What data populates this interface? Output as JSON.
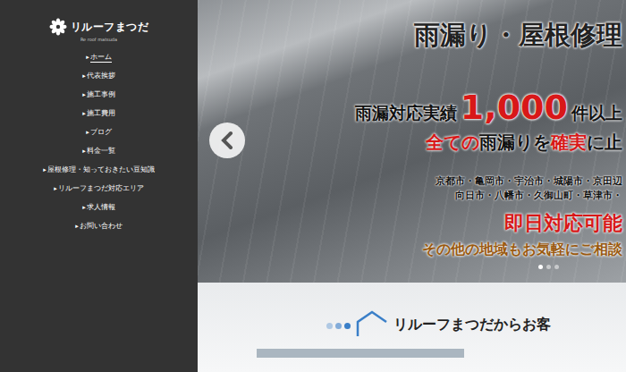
{
  "logo": {
    "name": "リルーフまつだ",
    "sub": "Re roof matsuda"
  },
  "nav_marker": "▸",
  "nav": [
    {
      "label": "ホーム",
      "selected": true
    },
    {
      "label": "代表挨拶",
      "selected": false
    },
    {
      "label": "施工事例",
      "selected": false
    },
    {
      "label": "施工費用",
      "selected": false
    },
    {
      "label": "ブログ",
      "selected": false
    },
    {
      "label": "料金一覧",
      "selected": false
    },
    {
      "label": "屋根修理・知っておきたい豆知識",
      "selected": false
    },
    {
      "label": "リルーフまつだ対応エリア",
      "selected": false
    },
    {
      "label": "求人情報",
      "selected": false
    },
    {
      "label": "お問い合わせ",
      "selected": false
    }
  ],
  "hero": {
    "title": "雨漏り・屋根修理",
    "record": {
      "prefix": "雨漏対応実績",
      "number": "1,000",
      "suffix": "件以上"
    },
    "promise": [
      {
        "text": "全ての",
        "emphasis": true
      },
      {
        "text": "雨漏り",
        "emphasis": false
      },
      {
        "text": "を",
        "emphasis": false
      },
      {
        "text": "確実",
        "emphasis": true
      },
      {
        "text": "に止",
        "emphasis": false
      }
    ],
    "areas": [
      "京都市・亀岡市・宇治市・城陽市・京田辺",
      "向日市・八幡市・久御山町・草津市・"
    ],
    "sameday": "即日対応可能",
    "other": "その他の地域もお気軽にご相談",
    "dots": [
      {
        "selected": true
      },
      {
        "selected": false
      },
      {
        "selected": false
      }
    ]
  },
  "section": {
    "heading": "リルーフまつだからお客"
  }
}
